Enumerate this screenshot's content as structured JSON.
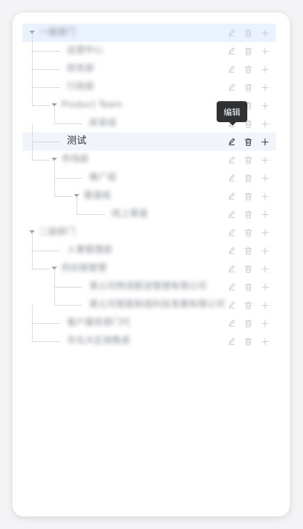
{
  "tree": {
    "rows": [
      {
        "label": "一级部门",
        "level": 0,
        "caret": true,
        "style": "highlight",
        "blur": true
      },
      {
        "label": "运营中心",
        "level": 1,
        "caret": false,
        "style": "",
        "blur": true
      },
      {
        "label": "财务部",
        "level": 1,
        "caret": false,
        "style": "",
        "blur": true
      },
      {
        "label": "行政部",
        "level": 1,
        "caret": false,
        "style": "",
        "blur": true
      },
      {
        "label": "Product Team",
        "level": 1,
        "caret": true,
        "style": "",
        "blur": true
      },
      {
        "label": "研发组",
        "level": 2,
        "caret": false,
        "style": "",
        "blur": true
      },
      {
        "label": "测试",
        "level": 1,
        "caret": false,
        "style": "hover active",
        "blur": false
      },
      {
        "label": "市场部",
        "level": 1,
        "caret": true,
        "style": "",
        "blur": true
      },
      {
        "label": "推广组",
        "level": 2,
        "caret": false,
        "style": "",
        "blur": true
      },
      {
        "label": "渠道组",
        "level": 2,
        "caret": true,
        "style": "",
        "blur": true
      },
      {
        "label": "线上渠道",
        "level": 3,
        "caret": false,
        "style": "",
        "blur": true
      },
      {
        "label": "二级部门",
        "level": 0,
        "caret": true,
        "style": "",
        "blur": true
      },
      {
        "label": "人事管理部",
        "level": 1,
        "caret": false,
        "style": "",
        "blur": true
      },
      {
        "label": "供应链管理",
        "level": 1,
        "caret": true,
        "style": "",
        "blur": true
      },
      {
        "label": "某公司物流配送管理有限公司",
        "level": 2,
        "caret": false,
        "style": "",
        "blur": true
      },
      {
        "label": "某公司智能制造科技发展有限公司",
        "level": 2,
        "caret": false,
        "style": "",
        "blur": true
      },
      {
        "label": "客户服务部门代",
        "level": 1,
        "caret": false,
        "style": "",
        "blur": true
      },
      {
        "label": "华北大区销售部",
        "level": 1,
        "caret": false,
        "style": "",
        "blur": true
      }
    ]
  },
  "tooltip": {
    "text": "编辑"
  },
  "icons": {
    "edit": "pencil-icon",
    "delete": "trash-icon",
    "add": "plus-icon"
  },
  "colors": {
    "highlight": "#eaf2fe",
    "hover": "#f1f4fa",
    "text": "#303133",
    "icon_idle": "#c9cbd0",
    "tooltip_bg": "#303133"
  }
}
